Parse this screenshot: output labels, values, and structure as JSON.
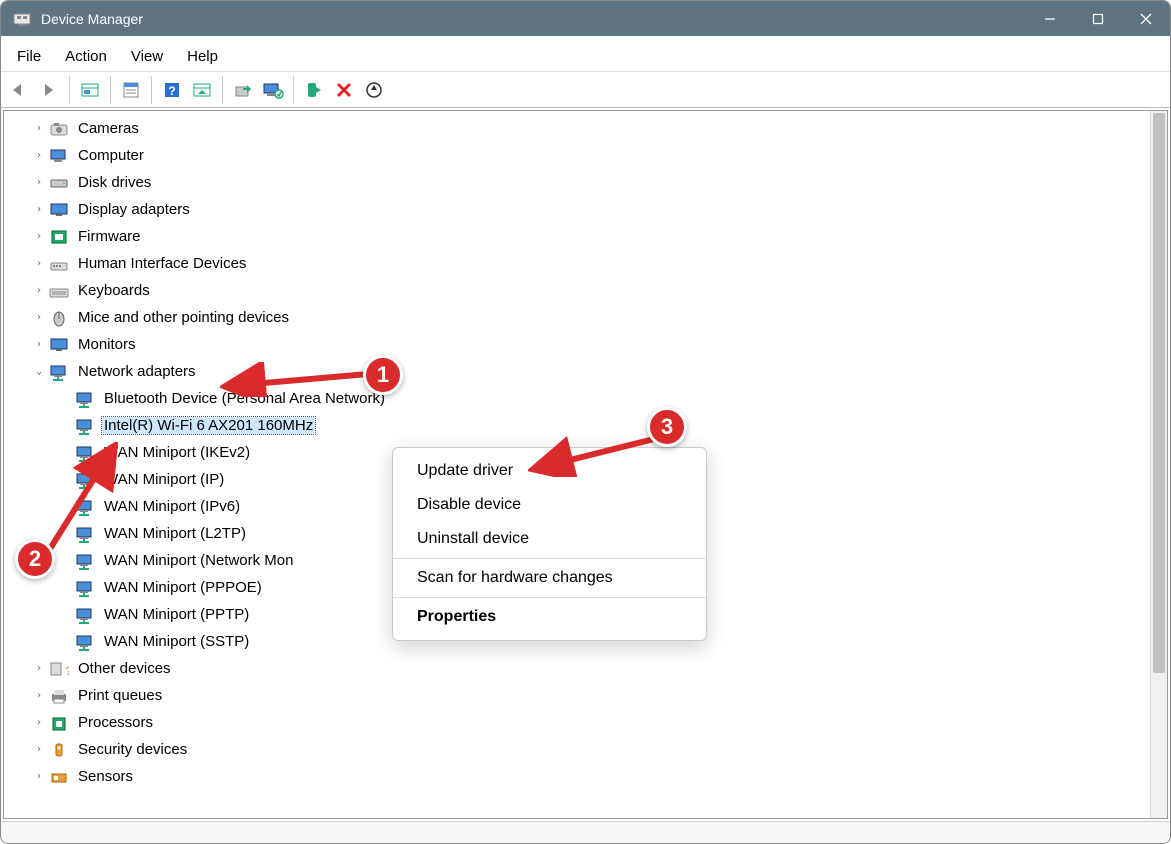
{
  "window": {
    "title": "Device Manager"
  },
  "menubar": [
    "File",
    "Action",
    "View",
    "Help"
  ],
  "toolbar_icons": [
    "back",
    "forward",
    "sep",
    "show-hidden",
    "sep",
    "properties-window",
    "sep",
    "help",
    "rescan-tb",
    "sep",
    "update-driver-tb",
    "monitor-tb",
    "sep",
    "enable",
    "disable",
    "uninstall"
  ],
  "tree": [
    {
      "label": "Cameras",
      "icon": "camera",
      "expanded": false
    },
    {
      "label": "Computer",
      "icon": "computer",
      "expanded": false
    },
    {
      "label": "Disk drives",
      "icon": "disk",
      "expanded": false
    },
    {
      "label": "Display adapters",
      "icon": "display",
      "expanded": false
    },
    {
      "label": "Firmware",
      "icon": "firmware",
      "expanded": false
    },
    {
      "label": "Human Interface Devices",
      "icon": "hid",
      "expanded": false
    },
    {
      "label": "Keyboards",
      "icon": "keyboard",
      "expanded": false
    },
    {
      "label": "Mice and other pointing devices",
      "icon": "mouse",
      "expanded": false
    },
    {
      "label": "Monitors",
      "icon": "monitor",
      "expanded": false
    },
    {
      "label": "Network adapters",
      "icon": "network",
      "expanded": true,
      "children": [
        {
          "label": "Bluetooth Device (Personal Area Network)",
          "icon": "network"
        },
        {
          "label": "Intel(R) Wi-Fi 6 AX201 160MHz",
          "icon": "network",
          "selected": true
        },
        {
          "label": "WAN Miniport (IKEv2)",
          "icon": "network"
        },
        {
          "label": "WAN Miniport (IP)",
          "icon": "network"
        },
        {
          "label": "WAN Miniport (IPv6)",
          "icon": "network"
        },
        {
          "label": "WAN Miniport (L2TP)",
          "icon": "network"
        },
        {
          "label": "WAN Miniport (Network Mon",
          "icon": "network"
        },
        {
          "label": "WAN Miniport (PPPOE)",
          "icon": "network"
        },
        {
          "label": "WAN Miniport (PPTP)",
          "icon": "network"
        },
        {
          "label": "WAN Miniport (SSTP)",
          "icon": "network"
        }
      ]
    },
    {
      "label": "Other devices",
      "icon": "other",
      "expanded": false
    },
    {
      "label": "Print queues",
      "icon": "printer",
      "expanded": false
    },
    {
      "label": "Processors",
      "icon": "processor",
      "expanded": false
    },
    {
      "label": "Security devices",
      "icon": "security",
      "expanded": false
    },
    {
      "label": "Sensors",
      "icon": "sensor",
      "expanded": false
    }
  ],
  "context_menu": {
    "groups": [
      [
        "Update driver",
        "Disable device",
        "Uninstall device"
      ],
      [
        "Scan for hardware changes"
      ],
      [
        "Properties"
      ]
    ],
    "bold_item": "Properties"
  },
  "annotations": {
    "badges": {
      "1": "1",
      "2": "2",
      "3": "3"
    }
  }
}
